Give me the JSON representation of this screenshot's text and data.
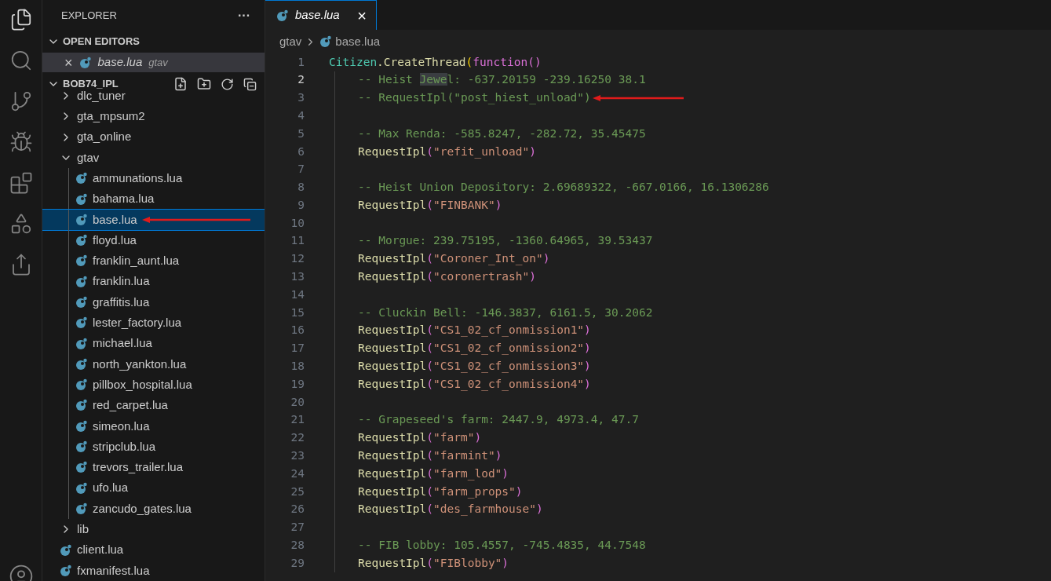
{
  "sidebar": {
    "title": "EXPLORER",
    "more": "···",
    "open_editors": {
      "title": "OPEN EDITORS",
      "expanded": true,
      "items": [
        {
          "name": "base.lua",
          "folder": "gtav",
          "close": "×",
          "selected": true
        }
      ]
    },
    "project": {
      "title": "BOB74_IPL",
      "expanded": true,
      "tree": [
        {
          "kind": "folder",
          "name": "dlc_tuner",
          "expanded": false,
          "selected": false
        },
        {
          "kind": "folder",
          "name": "gta_mpsum2",
          "expanded": false,
          "selected": false
        },
        {
          "kind": "folder",
          "name": "gta_online",
          "expanded": false,
          "selected": false
        },
        {
          "kind": "folder",
          "name": "gtav",
          "expanded": true,
          "selected": false,
          "children": [
            {
              "kind": "file",
              "name": "ammunations.lua",
              "selected": false,
              "annotated": false
            },
            {
              "kind": "file",
              "name": "bahama.lua",
              "selected": false,
              "annotated": false
            },
            {
              "kind": "file",
              "name": "base.lua",
              "selected": true,
              "annotated": true
            },
            {
              "kind": "file",
              "name": "floyd.lua",
              "selected": false,
              "annotated": false
            },
            {
              "kind": "file",
              "name": "franklin_aunt.lua",
              "selected": false,
              "annotated": false
            },
            {
              "kind": "file",
              "name": "franklin.lua",
              "selected": false,
              "annotated": false
            },
            {
              "kind": "file",
              "name": "graffitis.lua",
              "selected": false,
              "annotated": false
            },
            {
              "kind": "file",
              "name": "lester_factory.lua",
              "selected": false,
              "annotated": false
            },
            {
              "kind": "file",
              "name": "michael.lua",
              "selected": false,
              "annotated": false
            },
            {
              "kind": "file",
              "name": "north_yankton.lua",
              "selected": false,
              "annotated": false
            },
            {
              "kind": "file",
              "name": "pillbox_hospital.lua",
              "selected": false,
              "annotated": false
            },
            {
              "kind": "file",
              "name": "red_carpet.lua",
              "selected": false,
              "annotated": false
            },
            {
              "kind": "file",
              "name": "simeon.lua",
              "selected": false,
              "annotated": false
            },
            {
              "kind": "file",
              "name": "stripclub.lua",
              "selected": false,
              "annotated": false
            },
            {
              "kind": "file",
              "name": "trevors_trailer.lua",
              "selected": false,
              "annotated": false
            },
            {
              "kind": "file",
              "name": "ufo.lua",
              "selected": false,
              "annotated": false
            },
            {
              "kind": "file",
              "name": "zancudo_gates.lua",
              "selected": false,
              "annotated": false
            }
          ]
        },
        {
          "kind": "folder",
          "name": "lib",
          "expanded": false,
          "selected": false
        },
        {
          "kind": "file",
          "name": "client.lua",
          "selected": false,
          "annotated": false
        },
        {
          "kind": "file",
          "name": "fxmanifest.lua",
          "selected": false,
          "annotated": false
        }
      ]
    }
  },
  "tabs": [
    {
      "label": "base.lua",
      "close": "×",
      "selected": true
    }
  ],
  "breadcrumbs": [
    "gtav",
    "base.lua"
  ],
  "editor": {
    "lines": [
      {
        "number": "1",
        "current": false,
        "annotated": false,
        "tokens": [
          {
            "kind": "cls",
            "t": "Citizen"
          },
          {
            "kind": "plain",
            "t": ".CreateThread"
          },
          {
            "kind": "paren",
            "t": "("
          },
          {
            "kind": "kw",
            "t": "function"
          },
          {
            "kind": "kw",
            "t": "()"
          }
        ],
        "children": [
          {
            "number": "2",
            "current": true,
            "annotated": false,
            "tokens": [
              {
                "kind": "comment",
                "t": "-- Heist "
              },
              {
                "kind": "hl",
                "t": "Jewe"
              },
              {
                "kind": "comment",
                "t": "l: -637.20159 -239.16250 38.1"
              }
            ]
          },
          {
            "number": "3",
            "current": false,
            "annotated": true,
            "tokens": [
              {
                "kind": "comment",
                "t": "-- RequestIpl(\"post_hiest_unload\")"
              }
            ]
          },
          {
            "number": "4",
            "current": false,
            "annotated": false
          },
          {
            "number": "5",
            "current": false,
            "annotated": false,
            "tokens": [
              {
                "kind": "comment",
                "t": "-- Max Renda: -585.8247, -282.72, 35.45475"
              }
            ]
          },
          {
            "number": "6",
            "current": false,
            "annotated": false,
            "tokens": [
              {
                "kind": "fn",
                "t": "RequestIpl"
              },
              {
                "kind": "kw",
                "t": "("
              },
              {
                "kind": "str",
                "t": "\"refit_unload\""
              },
              {
                "kind": "kw",
                "t": ")"
              }
            ]
          },
          {
            "number": "7",
            "current": false,
            "annotated": false
          },
          {
            "number": "8",
            "current": false,
            "annotated": false,
            "tokens": [
              {
                "kind": "comment",
                "t": "-- Heist Union Depository: 2.69689322, -667.0166, 16.1306286"
              }
            ]
          },
          {
            "number": "9",
            "current": false,
            "annotated": false,
            "tokens": [
              {
                "kind": "fn",
                "t": "RequestIpl"
              },
              {
                "kind": "kw",
                "t": "("
              },
              {
                "kind": "str",
                "t": "\"FINBANK\""
              },
              {
                "kind": "kw",
                "t": ")"
              }
            ]
          },
          {
            "number": "10",
            "current": false,
            "annotated": false
          },
          {
            "number": "11",
            "current": false,
            "annotated": false,
            "tokens": [
              {
                "kind": "comment",
                "t": "-- Morgue: 239.75195, -1360.64965, 39.53437"
              }
            ]
          },
          {
            "number": "12",
            "current": false,
            "annotated": false,
            "tokens": [
              {
                "kind": "fn",
                "t": "RequestIpl"
              },
              {
                "kind": "kw",
                "t": "("
              },
              {
                "kind": "str",
                "t": "\"Coroner_Int_on\""
              },
              {
                "kind": "kw",
                "t": ")"
              }
            ]
          },
          {
            "number": "13",
            "current": false,
            "annotated": false,
            "tokens": [
              {
                "kind": "fn",
                "t": "RequestIpl"
              },
              {
                "kind": "kw",
                "t": "("
              },
              {
                "kind": "str",
                "t": "\"coronertrash\""
              },
              {
                "kind": "kw",
                "t": ")"
              }
            ]
          },
          {
            "number": "14",
            "current": false,
            "annotated": false
          },
          {
            "number": "15",
            "current": false,
            "annotated": false,
            "tokens": [
              {
                "kind": "comment",
                "t": "-- Cluckin Bell: -146.3837, 6161.5, 30.2062"
              }
            ]
          },
          {
            "number": "16",
            "current": false,
            "annotated": false,
            "tokens": [
              {
                "kind": "fn",
                "t": "RequestIpl"
              },
              {
                "kind": "kw",
                "t": "("
              },
              {
                "kind": "str",
                "t": "\"CS1_02_cf_onmission1\""
              },
              {
                "kind": "kw",
                "t": ")"
              }
            ]
          },
          {
            "number": "17",
            "current": false,
            "annotated": false,
            "tokens": [
              {
                "kind": "fn",
                "t": "RequestIpl"
              },
              {
                "kind": "kw",
                "t": "("
              },
              {
                "kind": "str",
                "t": "\"CS1_02_cf_onmission2\""
              },
              {
                "kind": "kw",
                "t": ")"
              }
            ]
          },
          {
            "number": "18",
            "current": false,
            "annotated": false,
            "tokens": [
              {
                "kind": "fn",
                "t": "RequestIpl"
              },
              {
                "kind": "kw",
                "t": "("
              },
              {
                "kind": "str",
                "t": "\"CS1_02_cf_onmission3\""
              },
              {
                "kind": "kw",
                "t": ")"
              }
            ]
          },
          {
            "number": "19",
            "current": false,
            "annotated": false,
            "tokens": [
              {
                "kind": "fn",
                "t": "RequestIpl"
              },
              {
                "kind": "kw",
                "t": "("
              },
              {
                "kind": "str",
                "t": "\"CS1_02_cf_onmission4\""
              },
              {
                "kind": "kw",
                "t": ")"
              }
            ]
          },
          {
            "number": "20",
            "current": false,
            "annotated": false
          },
          {
            "number": "21",
            "current": false,
            "annotated": false,
            "tokens": [
              {
                "kind": "comment",
                "t": "-- Grapeseed's farm: 2447.9, 4973.4, 47.7"
              }
            ]
          },
          {
            "number": "22",
            "current": false,
            "annotated": false,
            "tokens": [
              {
                "kind": "fn",
                "t": "RequestIpl"
              },
              {
                "kind": "kw",
                "t": "("
              },
              {
                "kind": "str",
                "t": "\"farm\""
              },
              {
                "kind": "kw",
                "t": ")"
              }
            ]
          },
          {
            "number": "23",
            "current": false,
            "annotated": false,
            "tokens": [
              {
                "kind": "fn",
                "t": "RequestIpl"
              },
              {
                "kind": "kw",
                "t": "("
              },
              {
                "kind": "str",
                "t": "\"farmint\""
              },
              {
                "kind": "kw",
                "t": ")"
              }
            ]
          },
          {
            "number": "24",
            "current": false,
            "annotated": false,
            "tokens": [
              {
                "kind": "fn",
                "t": "RequestIpl"
              },
              {
                "kind": "kw",
                "t": "("
              },
              {
                "kind": "str",
                "t": "\"farm_lod\""
              },
              {
                "kind": "kw",
                "t": ")"
              }
            ]
          },
          {
            "number": "25",
            "current": false,
            "annotated": false,
            "tokens": [
              {
                "kind": "fn",
                "t": "RequestIpl"
              },
              {
                "kind": "kw",
                "t": "("
              },
              {
                "kind": "str",
                "t": "\"farm_props\""
              },
              {
                "kind": "kw",
                "t": ")"
              }
            ]
          },
          {
            "number": "26",
            "current": false,
            "annotated": false,
            "tokens": [
              {
                "kind": "fn",
                "t": "RequestIpl"
              },
              {
                "kind": "kw",
                "t": "("
              },
              {
                "kind": "str",
                "t": "\"des_farmhouse\""
              },
              {
                "kind": "kw",
                "t": ")"
              }
            ]
          },
          {
            "number": "27",
            "current": false,
            "annotated": false
          },
          {
            "number": "28",
            "current": false,
            "annotated": false,
            "tokens": [
              {
                "kind": "comment",
                "t": "-- FIB lobby: 105.4557, -745.4835, 44.7548"
              }
            ]
          },
          {
            "number": "29",
            "current": false,
            "annotated": false,
            "tokens": [
              {
                "kind": "fn",
                "t": "RequestIpl"
              },
              {
                "kind": "kw",
                "t": "("
              },
              {
                "kind": "str",
                "t": "\"FIBlobby\""
              },
              {
                "kind": "kw",
                "t": ")"
              }
            ]
          }
        ]
      }
    ]
  }
}
